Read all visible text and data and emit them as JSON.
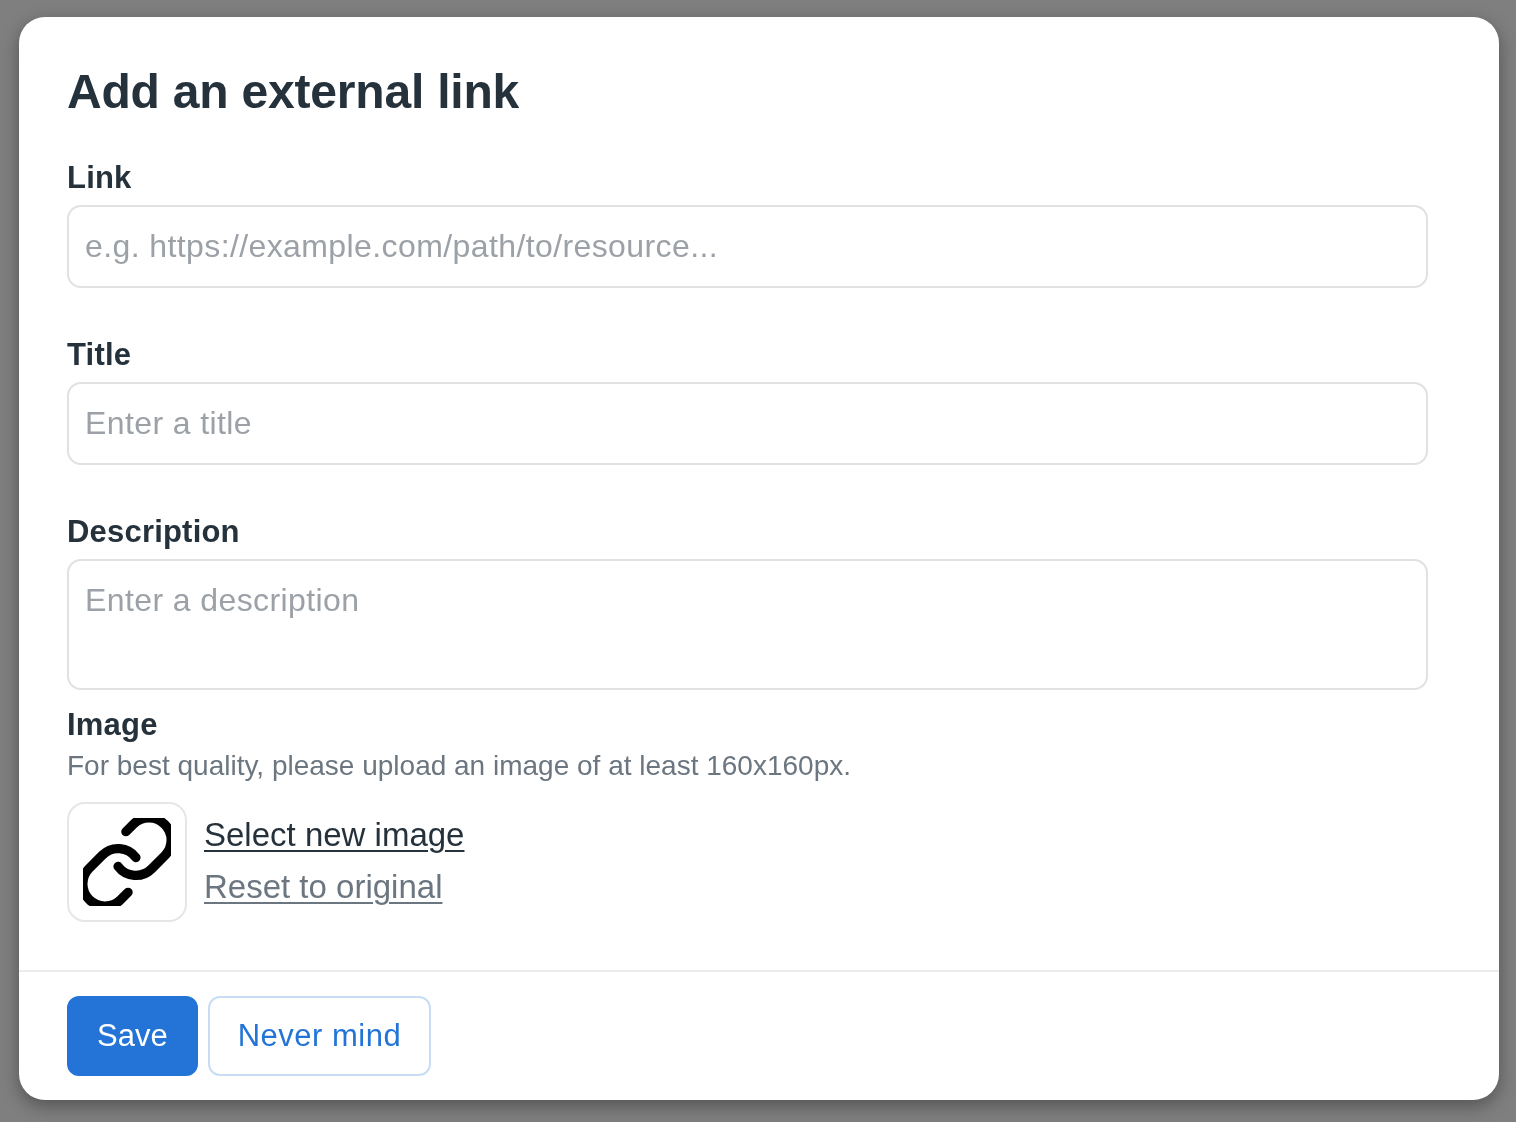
{
  "dialog": {
    "title": "Add an external link",
    "fields": [
      {
        "kind": "input",
        "label": "Link",
        "placeholder": "e.g. https://example.com/path/to/resource..."
      },
      {
        "kind": "input",
        "label": "Title",
        "placeholder": "Enter a title"
      },
      {
        "kind": "textarea",
        "label": "Description",
        "placeholder": "Enter a description"
      }
    ],
    "image": {
      "label": "Image",
      "hint": "For best quality, please upload an image of at least 160x160px.",
      "actions": [
        {
          "kind": "primary",
          "label": "Select new image"
        },
        {
          "kind": "secondary",
          "label": "Reset to original"
        }
      ]
    },
    "buttons": [
      {
        "kind": "primary",
        "label": "Save"
      },
      {
        "kind": "secondary",
        "label": "Never mind"
      }
    ]
  }
}
